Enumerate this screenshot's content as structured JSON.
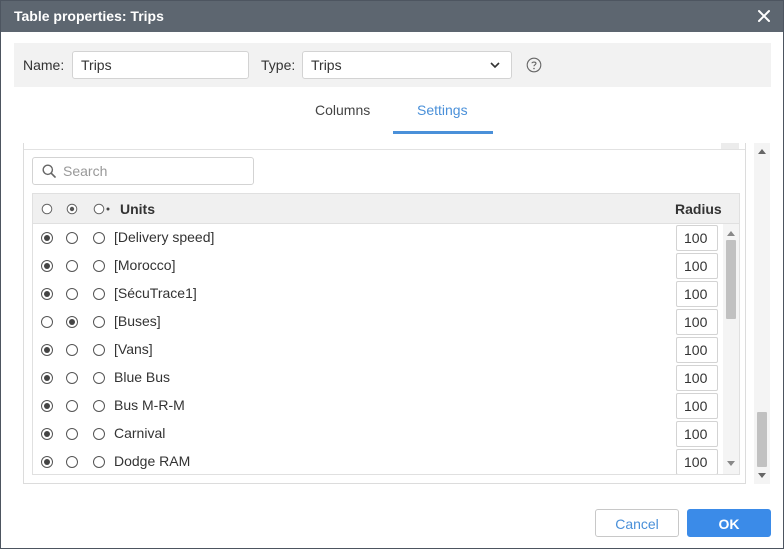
{
  "dialog": {
    "title": "Table properties: Trips",
    "close_icon": "close-icon"
  },
  "form": {
    "name_label": "Name:",
    "name_value": "Trips",
    "type_label": "Type:",
    "type_value": "Trips",
    "help_icon": "question-circle-icon"
  },
  "tabs": [
    {
      "label": "Columns",
      "active": false
    },
    {
      "label": "Settings",
      "active": true
    }
  ],
  "search": {
    "placeholder": "Search",
    "value": ""
  },
  "table": {
    "units_header": "Units",
    "radius_header": "Radius",
    "rows": [
      {
        "name": "[Delivery speed]",
        "selected_option": 1,
        "radius": "100"
      },
      {
        "name": "[Morocco]",
        "selected_option": 1,
        "radius": "100"
      },
      {
        "name": "[SécuTrace1]",
        "selected_option": 1,
        "radius": "100"
      },
      {
        "name": "[Buses]",
        "selected_option": 2,
        "radius": "100"
      },
      {
        "name": "[Vans]",
        "selected_option": 1,
        "radius": "100"
      },
      {
        "name": "Blue Bus",
        "selected_option": 1,
        "radius": "100"
      },
      {
        "name": "Bus M-R-M",
        "selected_option": 1,
        "radius": "100"
      },
      {
        "name": "Carnival",
        "selected_option": 1,
        "radius": "100"
      },
      {
        "name": "Dodge RAM",
        "selected_option": 1,
        "radius": "100"
      }
    ]
  },
  "buttons": {
    "cancel": "Cancel",
    "ok": "OK"
  },
  "colors": {
    "titlebar": "#5d6670",
    "accent": "#4a90d9",
    "ok_button": "#3b8be8"
  }
}
